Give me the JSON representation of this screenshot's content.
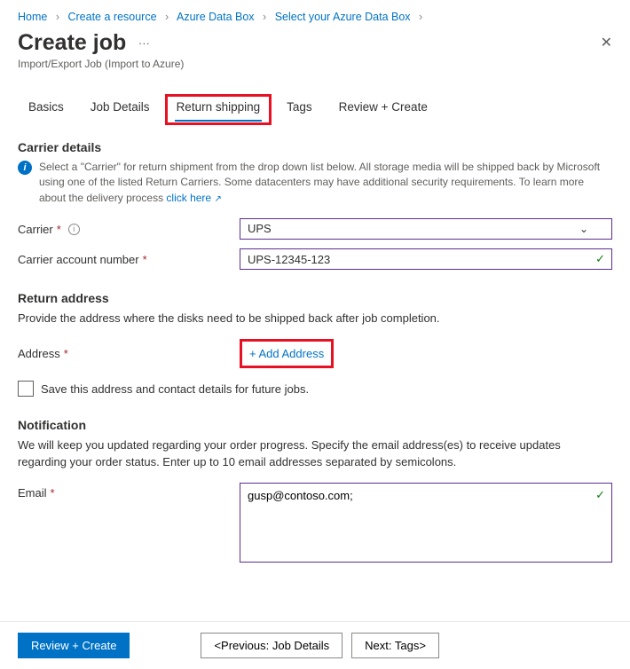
{
  "breadcrumbs": [
    "Home",
    "Create a resource",
    "Azure Data Box",
    "Select your Azure Data Box"
  ],
  "header": {
    "title": "Create job",
    "subtitle": "Import/Export Job (Import to Azure)"
  },
  "tabs": [
    "Basics",
    "Job Details",
    "Return shipping",
    "Tags",
    "Review + Create"
  ],
  "active_tab": "Return shipping",
  "carrier_section": {
    "heading": "Carrier details",
    "info": "Select a \"Carrier\" for return shipment from the drop down list below. All storage media will be shipped back by Microsoft using one of the listed Return Carriers. Some datacenters may have additional security requirements. To learn more about the delivery process ",
    "info_link": "click here",
    "carrier_label": "Carrier",
    "carrier_value": "UPS",
    "account_label": "Carrier account number",
    "account_value": "UPS-12345-123"
  },
  "return_section": {
    "heading": "Return address",
    "desc": "Provide the address where the disks need to be shipped back after job completion.",
    "address_label": "Address",
    "add_address": "+ Add Address",
    "save_label": "Save this address and contact details for future jobs."
  },
  "notification_section": {
    "heading": "Notification",
    "desc": "We will keep you updated regarding your order progress. Specify the email address(es) to receive updates regarding your order status. Enter up to 10 email addresses separated by semicolons.",
    "email_label": "Email",
    "email_value": "gusp@contoso.com;"
  },
  "footer": {
    "review": "Review + Create",
    "prev": "<Previous: Job Details",
    "next": "Next: Tags>"
  }
}
